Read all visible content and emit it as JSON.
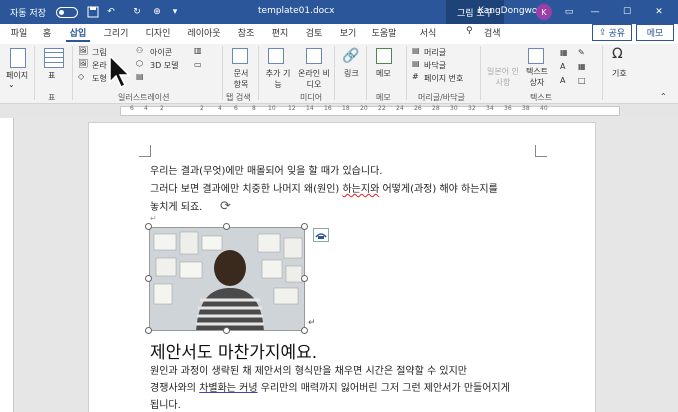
{
  "titlebar": {
    "autosave_label": "자동 저장",
    "autosave_state": "끔",
    "doc_title": "template01.docx",
    "contextual_tab": "그림 도구",
    "user_name": "KangDongwoo",
    "user_initial": "K"
  },
  "tabs": [
    "파일",
    "홈",
    "삽입",
    "그리기",
    "디자인",
    "레이아웃",
    "참조",
    "편지",
    "검토",
    "보기",
    "도움말",
    "서식"
  ],
  "active_tab": "삽입",
  "search_label": "검색",
  "share_label": "공유",
  "memo_label": "메모",
  "ribbon": {
    "page": "페이지",
    "table": "표",
    "table_group": "표",
    "picture": "그림",
    "online_picture": "온라",
    "shape": "도형",
    "icons": "아이콘",
    "model3d": "3D 모델",
    "illustrations_group": "일러스트레이션",
    "addin": "추가 기능",
    "online_video": "온라인 비디오",
    "media_group": "미디어",
    "doc_item": "문서 항목",
    "tab_search_group": "탭 검색",
    "link": "링크",
    "memo": "메모",
    "memo_group": "메모",
    "header": "머리글",
    "footer": "바닥글",
    "page_number": "페이지 번호",
    "header_footer_group": "머리글/바닥글",
    "japanese": "일본어 인 사항",
    "textbox": "텍스트 상자",
    "text_group": "텍스트",
    "symbol": "기호"
  },
  "ruler_marks": [
    "6",
    "4",
    "2",
    "",
    "2",
    "4",
    "6",
    "8",
    "10",
    "12",
    "14",
    "16",
    "18",
    "20",
    "22",
    "24",
    "26",
    "28",
    "30",
    "32",
    "34",
    "36",
    "38",
    "40"
  ],
  "doc": {
    "line1": "우리는 결과(무엇)에만 매몰되어 잊을 할 때가 있습니다.",
    "line2a": "그러다 보면 결과에만 치중한 나머지 왜(원인) ",
    "line2b": "하는지와",
    "line2c": " 어떻게(과정) 해야 하는지를",
    "line3": "놓치게 되죠.",
    "heading": "제안서도 마찬가지예요.",
    "body1": "원인과 과정이 생략된 채 제안서의 형식만을 채우면 시간은 절약할 수 있지만",
    "body2a": "경쟁사와의 ",
    "body2b": "차별화는 커녕",
    "body2c": " 우리만의 매력까지 잃어버린 그저 그런 제안서가 만들어지게",
    "body3": "됩니다."
  },
  "colors": {
    "accent": "#2b579a",
    "titlebar": "#2b579a",
    "contextual": "#1e4379"
  }
}
